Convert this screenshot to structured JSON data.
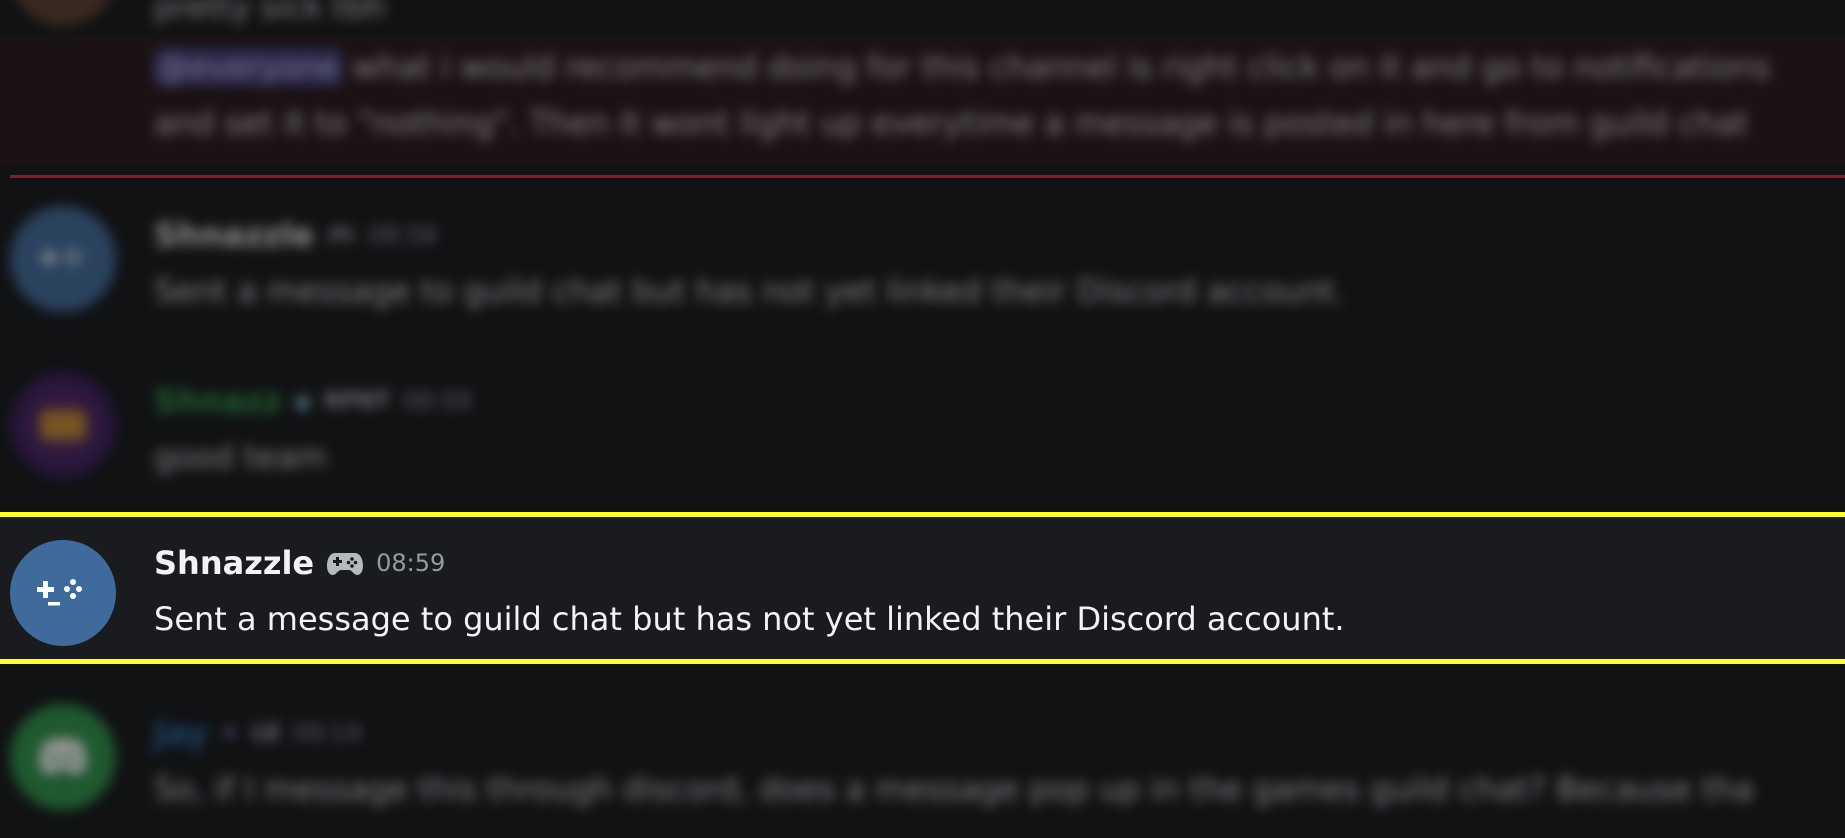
{
  "colors": {
    "background": "#111214",
    "highlight_border": "#ffff26",
    "new_messages_divider": "#8c1a20",
    "shnazz_name": "#2aa149",
    "jay_name": "#2a6fb5",
    "shnazzle_avatar": "#3f6a9c",
    "jay_avatar": "#2a9346"
  },
  "messages": [
    {
      "body": "pretty sick tbh"
    },
    {
      "mention": "@everyone",
      "body_line1": "what i would recommend doing for this channel is right click on it and go to notifications",
      "body_line2": "and set it to \"nothing\". Then it wont light up everytime a message is posted in here from guild chat"
    },
    {
      "username": "Shnazzle",
      "badge_icon": "gamepad-icon",
      "timestamp": "08:58",
      "body": "Sent a message to guild chat but has not yet linked their Discord account."
    },
    {
      "username": "Shnazz",
      "role_tag": "RPNT",
      "timestamp": "08:59",
      "body": "good team"
    },
    {
      "username": "Shnazzle",
      "badge_icon": "gamepad-icon",
      "timestamp": "08:59",
      "body": "Sent a message to guild chat but has not yet linked their Discord account."
    },
    {
      "username": "Jay",
      "role_tag": "LE",
      "timestamp": "09:14",
      "body": "So, if I message this through discord, does a message pop up in the games guild chat? Because tha"
    }
  ]
}
